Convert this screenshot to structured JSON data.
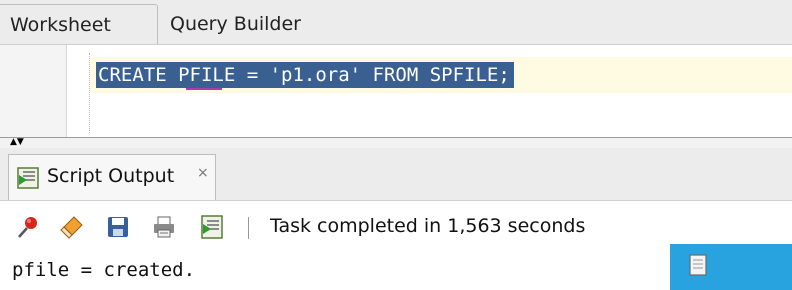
{
  "tabs": {
    "worksheet": "Worksheet",
    "query_builder": "Query Builder"
  },
  "editor": {
    "sql": "CREATE PFILE = 'p1.ora' FROM SPFILE;"
  },
  "output_panel": {
    "tab_label": "Script Output",
    "close_glyph": "×",
    "status": "Task completed in 1,563 seconds",
    "result": "pfile = created.",
    "toolbar_icons": [
      "pin-icon",
      "eraser-icon",
      "save-icon",
      "print-icon",
      "script-output-icon"
    ]
  },
  "colors": {
    "selection": "#3a5f91",
    "current_line": "#fffbe3",
    "corner_tile": "#29a3e0"
  }
}
